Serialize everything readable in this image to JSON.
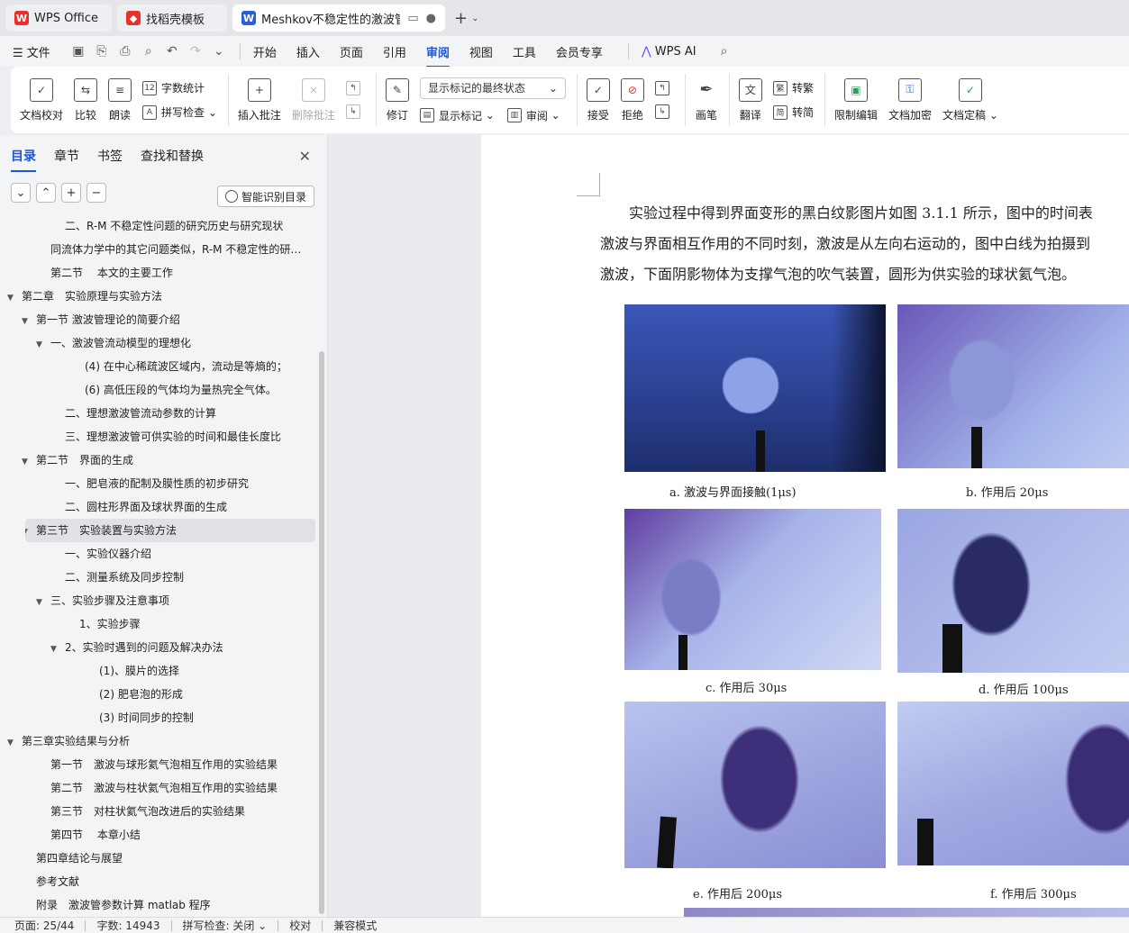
{
  "tabs": [
    {
      "label": "WPS Office",
      "icon": "wps-logo-icon",
      "color": "#e8302a"
    },
    {
      "label": "找稻壳模板",
      "icon": "docer-logo-icon",
      "color": "#e8302a"
    },
    {
      "label": "Meshkov不稳定性的激波管实",
      "icon": "word-doc-icon",
      "color": "#2b5fd9"
    }
  ],
  "menu": {
    "file_label": "文件",
    "items": [
      "开始",
      "插入",
      "页面",
      "引用",
      "审阅",
      "视图",
      "工具",
      "会员专享"
    ],
    "active": "审阅",
    "wps_ai": "WPS AI"
  },
  "ribbon": {
    "doc_check": "文档校对",
    "compare": "比较",
    "read_aloud": "朗读",
    "word_count": "字数统计",
    "spell_check": "拼写检查",
    "insert_comment": "插入批注",
    "delete_comment": "删除批注",
    "revise": "修订",
    "markup_dropdown": "显示标记的最终状态",
    "show_markup": "显示标记",
    "review": "审阅",
    "accept": "接受",
    "reject": "拒绝",
    "pen": "画笔",
    "translate": "翻译",
    "to_traditional": "转繁",
    "to_simplified": "转简",
    "restrict_edit": "限制编辑",
    "encrypt": "文档加密",
    "finalize": "文档定稿"
  },
  "sidebar": {
    "tabs": [
      "目录",
      "章节",
      "书签",
      "查找和替换"
    ],
    "smart_toc": "智能识别目录",
    "toc": [
      {
        "text": "二、R-M 不稳定性问题的研究历史与研究现状",
        "indent": 72,
        "caret": ""
      },
      {
        "text": "同流体力学中的其它问题类似，R-M 不稳定性的研究...",
        "indent": 56,
        "caret": ""
      },
      {
        "text": "第二节　 本文的主要工作",
        "indent": 56,
        "caret": ""
      },
      {
        "text": "第二章　实验原理与实验方法",
        "indent": 24,
        "caret": "▼"
      },
      {
        "text": "第一节  激波管理论的简要介绍",
        "indent": 40,
        "caret": "▼"
      },
      {
        "text": "一、激波管流动模型的理想化",
        "indent": 56,
        "caret": "▼"
      },
      {
        "text": "(4)  在中心稀疏波区域内，流动是等熵的；",
        "indent": 94,
        "caret": ""
      },
      {
        "text": "(6)  高低压段的气体均为量热完全气体。",
        "indent": 94,
        "caret": ""
      },
      {
        "text": "二、理想激波管流动参数的计算",
        "indent": 72,
        "caret": ""
      },
      {
        "text": "三、理想激波管可供实验的时间和最佳长度比",
        "indent": 72,
        "caret": ""
      },
      {
        "text": "第二节　界面的生成",
        "indent": 40,
        "caret": "▼"
      },
      {
        "text": "一、肥皂液的配制及膜性质的初步研究",
        "indent": 72,
        "caret": ""
      },
      {
        "text": "二、圆柱形界面及球状界面的生成",
        "indent": 72,
        "caret": ""
      },
      {
        "text": "第三节　实验装置与实验方法",
        "indent": 40,
        "caret": "▼",
        "selected": true
      },
      {
        "text": "一、实验仪器介绍",
        "indent": 72,
        "caret": ""
      },
      {
        "text": "二、测量系统及同步控制",
        "indent": 72,
        "caret": ""
      },
      {
        "text": "三、实验步骤及注意事项",
        "indent": 56,
        "caret": "▼"
      },
      {
        "text": "1、实验步骤",
        "indent": 88,
        "caret": ""
      },
      {
        "text": "2、实验时遇到的问题及解决办法",
        "indent": 72,
        "caret": "▼"
      },
      {
        "text": "(1)、膜片的选择",
        "indent": 110,
        "caret": ""
      },
      {
        "text": "(2)  肥皂泡的形成",
        "indent": 110,
        "caret": ""
      },
      {
        "text": "(3)  时间同步的控制",
        "indent": 110,
        "caret": ""
      },
      {
        "text": "第三章实验结果与分析",
        "indent": 24,
        "caret": "▼"
      },
      {
        "text": "第一节　激波与球形氦气泡相互作用的实验结果",
        "indent": 56,
        "caret": ""
      },
      {
        "text": "第二节　激波与柱状氦气泡相互作用的实验结果",
        "indent": 56,
        "caret": ""
      },
      {
        "text": "第三节　对柱状氦气泡改进后的实验结果",
        "indent": 56,
        "caret": ""
      },
      {
        "text": "第四节　 本章小结",
        "indent": 56,
        "caret": ""
      },
      {
        "text": "第四章结论与展望",
        "indent": 40,
        "caret": ""
      },
      {
        "text": "参考文献",
        "indent": 40,
        "caret": ""
      },
      {
        "text": "附录　激波管参数计算 matlab 程序",
        "indent": 40,
        "caret": ""
      }
    ]
  },
  "document": {
    "lines": [
      "　　实验过程中得到界面变形的黑白纹影图片如图 3.1.1 所示，图中的时间表",
      "激波与界面相互作用的不同时刻，激波是从左向右运动的，图中白线为拍摄到",
      "激波，下面阴影物体为支撑气泡的吹气装置，圆形为供实验的球状氦气泡。"
    ],
    "captions": [
      "a.  激波与界面接触(1μs)",
      "b.  作用后 20μs",
      "c.  作用后 30μs",
      "d.  作用后 100μs",
      "e.  作用后 200μs",
      "f.  作用后 300μs"
    ]
  },
  "status": {
    "page": "页面: 25/44",
    "words": "字数: 14943",
    "spell": "拼写检查: 关闭",
    "proof": "校对",
    "compat": "兼容模式"
  }
}
